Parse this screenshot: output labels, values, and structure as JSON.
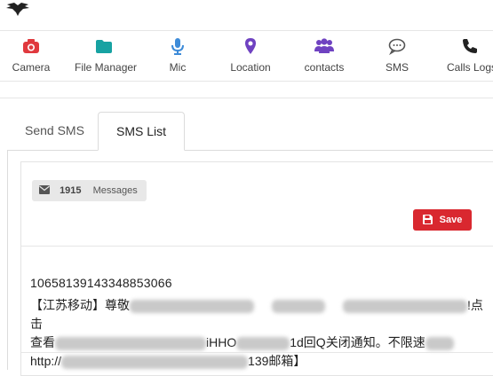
{
  "nav": {
    "items": [
      {
        "label": "Camera",
        "icon": "camera-icon",
        "color": "#e0393e"
      },
      {
        "label": "File Manager",
        "icon": "folder-icon",
        "color": "#17a2a2"
      },
      {
        "label": "Mic",
        "icon": "mic-icon",
        "color": "#3d8bd8"
      },
      {
        "label": "Location",
        "icon": "map-pin-icon",
        "color": "#6f42c1"
      },
      {
        "label": "contacts",
        "icon": "users-icon",
        "color": "#6f42c1"
      },
      {
        "label": "SMS",
        "icon": "chat-icon",
        "color": "#555555"
      },
      {
        "label": "Calls Logs",
        "icon": "phone-icon",
        "color": "#222222"
      }
    ]
  },
  "tabs": [
    {
      "label": "Send SMS",
      "active": false
    },
    {
      "label": "SMS List",
      "active": true
    }
  ],
  "sms_list": {
    "badge_count": "1915",
    "badge_label": "Messages",
    "save_label": "Save",
    "save_color": "#d9282f",
    "message": {
      "sender": "10658139143348853066",
      "text_line1_start": "【江苏移动】尊敬",
      "text_line1_end": "!点击",
      "text_line2_start": "查看",
      "text_line2_mid": "iHHO",
      "text_line2_end": "1d回Q关闭通知。不限速",
      "text_line3_start": "http://",
      "text_line3_end": "139邮箱】"
    }
  }
}
